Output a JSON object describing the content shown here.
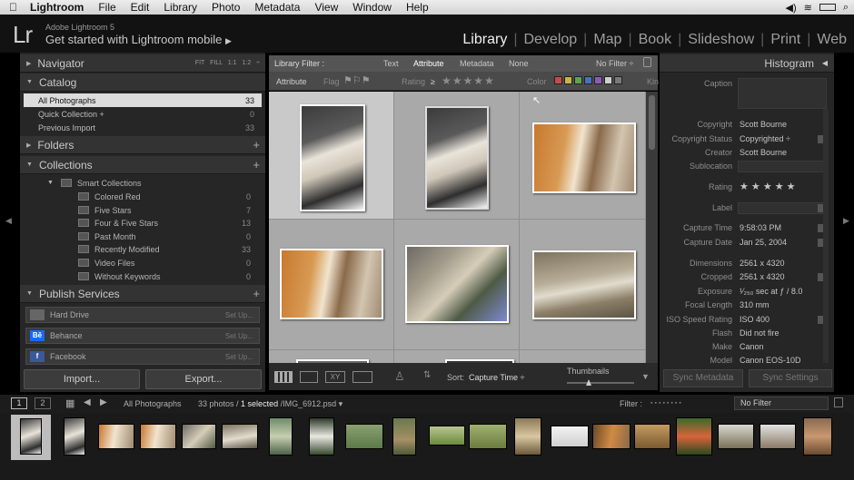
{
  "menubar": {
    "app": "Lightroom",
    "items": [
      "File",
      "Edit",
      "Library",
      "Photo",
      "Metadata",
      "View",
      "Window",
      "Help"
    ]
  },
  "identity": {
    "logo": "Lr",
    "small": "Adobe Lightroom 5",
    "big": "Get started with Lightroom mobile",
    "arrow": "▶"
  },
  "modules": [
    "Library",
    "Develop",
    "Map",
    "Book",
    "Slideshow",
    "Print",
    "Web"
  ],
  "active_module": "Library",
  "left": {
    "navigator": {
      "title": "Navigator",
      "zoom": "FIT   FILL   1:1   1:2 ÷"
    },
    "catalog": {
      "title": "Catalog",
      "rows": [
        {
          "label": "All Photographs",
          "count": "33"
        },
        {
          "label": "Quick Collection  +",
          "count": "0"
        },
        {
          "label": "Previous Import",
          "count": "33"
        }
      ]
    },
    "folders": {
      "title": "Folders"
    },
    "collections": {
      "title": "Collections",
      "group": "Smart Collections",
      "rows": [
        {
          "label": "Colored Red",
          "count": "0"
        },
        {
          "label": "Five Stars",
          "count": "7"
        },
        {
          "label": "Four & Five Stars",
          "count": "13"
        },
        {
          "label": "Past Month",
          "count": "0"
        },
        {
          "label": "Recently Modified",
          "count": "33"
        },
        {
          "label": "Video Files",
          "count": "0"
        },
        {
          "label": "Without Keywords",
          "count": "0"
        }
      ]
    },
    "publish": {
      "title": "Publish Services",
      "rows": [
        {
          "label": "Hard Drive",
          "setup": "Set Up...",
          "icon": "Hd"
        },
        {
          "label": "Behance",
          "setup": "Set Up...",
          "icon": "Bē"
        },
        {
          "label": "Facebook",
          "setup": "Set Up...",
          "icon": "f"
        }
      ]
    },
    "import_label": "Import...",
    "export_label": "Export..."
  },
  "filter": {
    "title": "Library Filter :",
    "tabs": [
      "Text",
      "Attribute",
      "Metadata",
      "None"
    ],
    "preset": "No Filter ÷",
    "attr": {
      "attribute": "Attribute",
      "flag": "Flag",
      "rating": "Rating",
      "rating_op": "≥",
      "color": "Color",
      "kind": "Kin"
    },
    "stars": "★★★★★",
    "swatches": [
      "#c84a4a",
      "#c9b44a",
      "#5ea34f",
      "#4a70c4",
      "#8c5bb3",
      "#cfcfcf",
      "#7a7a7a"
    ]
  },
  "toolbar": {
    "sort_label": "Sort:",
    "sort_value": "Capture Time ÷",
    "thumbs_label": "Thumbnails"
  },
  "right": {
    "histogram": "Histogram",
    "rows": [
      {
        "k": "Caption",
        "v": ""
      },
      {
        "k": "Copyright",
        "v": "Scott Bourne"
      },
      {
        "k": "Copyright Status",
        "v": "Copyrighted ÷"
      },
      {
        "k": "Creator",
        "v": "Scott Bourne"
      },
      {
        "k": "Sublocation",
        "v": ""
      },
      {
        "k": "Rating",
        "v": "★ ★ ★ ★ ★"
      },
      {
        "k": "Label",
        "v": ""
      },
      {
        "k": "Capture Time",
        "v": "9:58:03 PM"
      },
      {
        "k": "Capture Date",
        "v": "Jan 25, 2004"
      },
      {
        "k": "Dimensions",
        "v": "2561 x 4320"
      },
      {
        "k": "Cropped",
        "v": "2561 x 4320"
      },
      {
        "k": "Exposure",
        "v": "¹⁄₂₅₀ sec at ƒ / 8.0"
      },
      {
        "k": "Focal Length",
        "v": "310 mm"
      },
      {
        "k": "ISO Speed Rating",
        "v": "ISO 400"
      },
      {
        "k": "Flash",
        "v": "Did not fire"
      },
      {
        "k": "Make",
        "v": "Canon"
      },
      {
        "k": "Model",
        "v": "Canon EOS-10D"
      }
    ],
    "sync_metadata": "Sync Metadata",
    "sync_settings": "Sync Settings"
  },
  "filmstrip_bar": {
    "source": "All Photographs",
    "count": "33 photos / ",
    "selected": "1 selected",
    "file": " /IMG_6912.psd ▾",
    "filter_label": "Filter :",
    "filter_value": "No Filter",
    "page1": "1",
    "page2": "2"
  }
}
